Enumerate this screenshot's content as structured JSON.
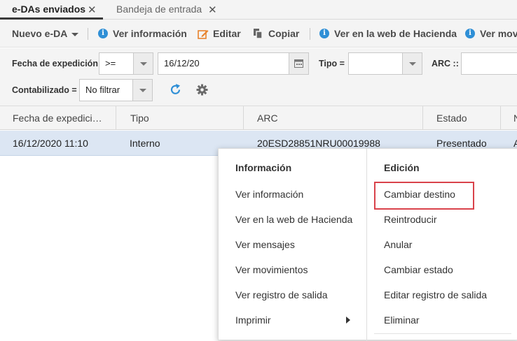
{
  "tabs": [
    {
      "label": "e-DAs enviados",
      "close": "✕"
    },
    {
      "label": "Bandeja de entrada",
      "close": "✕"
    }
  ],
  "toolbar": {
    "nuevo": "Nuevo e-DA",
    "ver_informacion": "Ver información",
    "editar": "Editar",
    "copiar": "Copiar",
    "ver_web": "Ver en la web de Hacienda",
    "ver_mov": "Ver mov"
  },
  "filters": {
    "fecha_label": "Fecha de expedición",
    "fecha_operator": ">=",
    "fecha_value": "16/12/20",
    "tipo_label": "Tipo =",
    "tipo_value": "",
    "arc_label": "ARC ::",
    "arc_value": "",
    "contab_label": "Contabilizado =",
    "contab_value": "No filtrar"
  },
  "grid": {
    "headers": [
      "Fecha de expedici…",
      "Tipo",
      "ARC",
      "Estado",
      "N"
    ],
    "row": [
      "16/12/2020 11:10",
      "Interno",
      "20ESD28851NRU00019988",
      "Presentado",
      "A"
    ]
  },
  "context_menu": {
    "info_header": "Información",
    "info_items": [
      "Ver información",
      "Ver en la web de Hacienda",
      "Ver mensajes",
      "Ver movimientos",
      "Ver registro de salida",
      "Imprimir"
    ],
    "edit_header": "Edición",
    "edit_items": [
      "Cambiar destino",
      "Reintroducir",
      "Anular",
      "Cambiar estado",
      "Editar registro de salida",
      "Eliminar"
    ]
  },
  "colors": {
    "accent_blue": "#2f8fd6",
    "edit_orange": "#e8822b",
    "highlight_red": "#d9434b",
    "row_selected": "#dce6f3"
  }
}
